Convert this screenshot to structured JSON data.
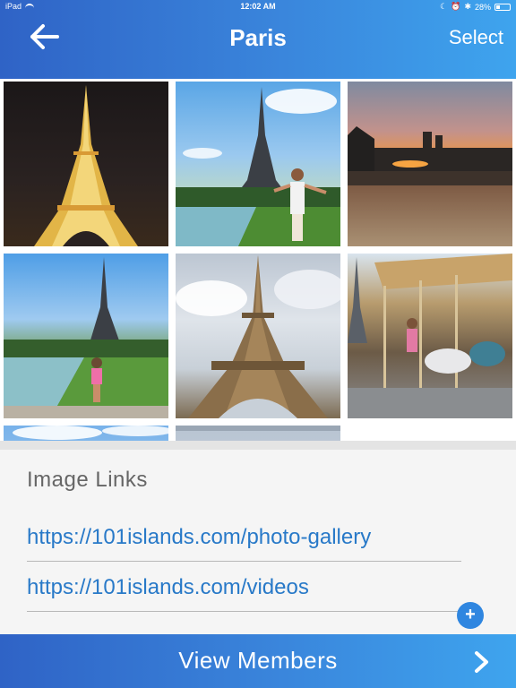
{
  "status_bar": {
    "device": "iPad",
    "time": "12:02 AM",
    "battery": "28%"
  },
  "header": {
    "back_icon": "back-arrow-icon",
    "title": "Paris",
    "select_label": "Select"
  },
  "photos": [
    {
      "subject": "Eiffel Tower at night"
    },
    {
      "subject": "Person at Trocadéro gardens"
    },
    {
      "subject": "Sunset over Seine"
    },
    {
      "subject": "Girl at Trocadéro gardens"
    },
    {
      "subject": "Eiffel Tower close-up"
    },
    {
      "subject": "Carousel near Eiffel Tower"
    },
    {
      "subject": "Partial photo"
    },
    {
      "subject": "Partial photo"
    }
  ],
  "image_links": {
    "heading": "Image Links",
    "items": [
      "https://101islands.com/photo-gallery",
      "https://101islands.com/videos"
    ],
    "add_label": "+"
  },
  "footer": {
    "label": "View Members",
    "chevron_icon": "chevron-right-icon"
  },
  "colors": {
    "header_start": "#2f63c6",
    "header_end": "#3ea4ee",
    "link": "#2879c8",
    "add_button": "#2f86e0"
  }
}
